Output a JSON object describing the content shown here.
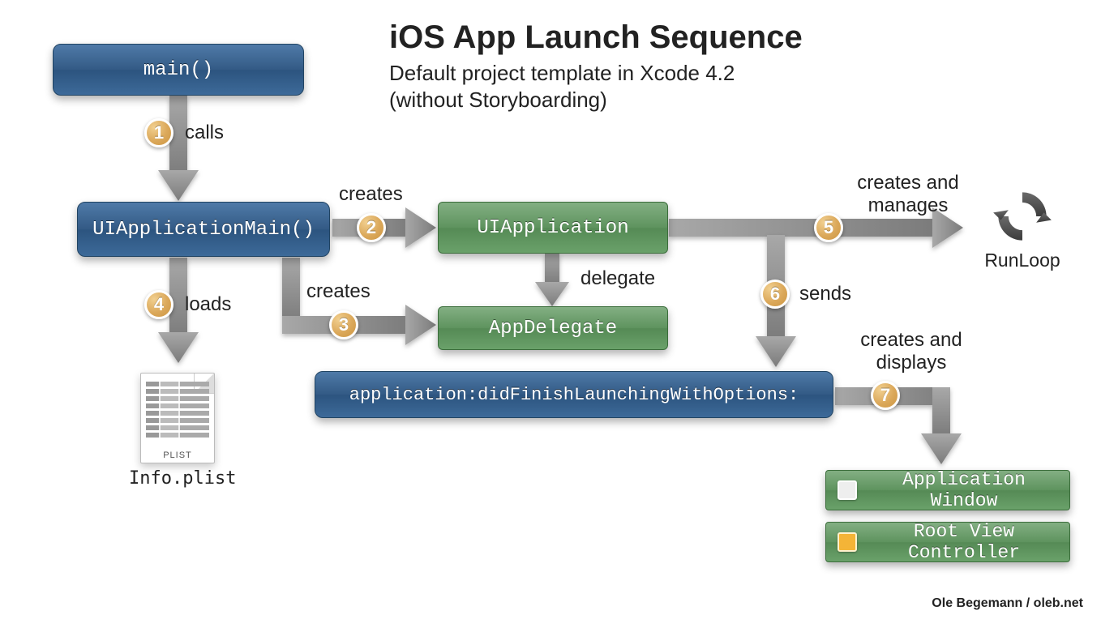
{
  "title": "iOS App Launch Sequence",
  "subtitle_line1": "Default project template in Xcode 4.2",
  "subtitle_line2": "(without Storyboarding)",
  "boxes": {
    "main": "main()",
    "uiapplicationmain": "UIApplicationMain()",
    "uiapplication": "UIApplication",
    "appdelegate": "AppDelegate",
    "didfinish": "application:didFinishLaunchingWithOptions:",
    "appwindow": "Application Window",
    "rootvc": "Root View Controller"
  },
  "steps": {
    "s1": "1",
    "s2": "2",
    "s3": "3",
    "s4": "4",
    "s5": "5",
    "s6": "6",
    "s7": "7"
  },
  "labels": {
    "calls": "calls",
    "creates2": "creates",
    "creates3": "creates",
    "loads": "loads",
    "creates_manages": "creates and manages",
    "sends": "sends",
    "delegate": "delegate",
    "creates_displays": "creates and displays"
  },
  "plist": {
    "tag": "PLIST",
    "filename": "Info.plist"
  },
  "runloop": "RunLoop",
  "credit": "Ole Begemann / oleb.net"
}
